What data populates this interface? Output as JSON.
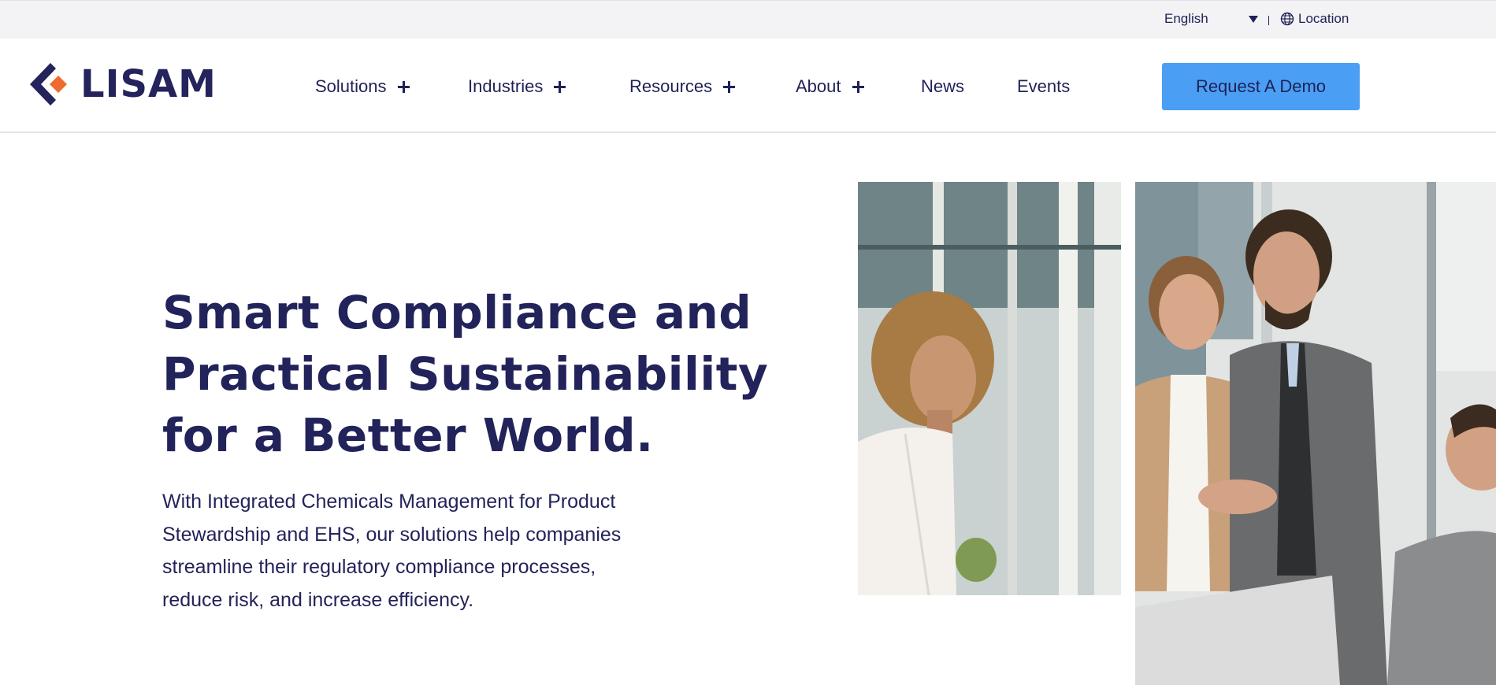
{
  "topbar": {
    "language": "English",
    "location": "Location",
    "icons": {
      "caret": "caret-down-icon",
      "globe": "globe-icon"
    }
  },
  "header": {
    "logo_text": "LISAM",
    "nav": [
      {
        "label": "Solutions",
        "expandable": true
      },
      {
        "label": "Industries",
        "expandable": true
      },
      {
        "label": "Resources",
        "expandable": true
      },
      {
        "label": "About",
        "expandable": true
      },
      {
        "label": "News",
        "expandable": false
      },
      {
        "label": "Events",
        "expandable": false
      }
    ],
    "cta": "Request A Demo"
  },
  "hero": {
    "title_lines": [
      "Smart Compliance and",
      "Practical Sustainability",
      "for a Better World."
    ],
    "description_lines": [
      "With Integrated Chemicals Management for Product",
      "Stewardship and EHS, our solutions help companies",
      "streamline their regulatory compliance processes,",
      "reduce risk, and increase efficiency."
    ]
  },
  "colors": {
    "navy": "#1f2156",
    "cta_blue": "#4a9ff5",
    "logo_orange": "#ef6a2c",
    "topbar_bg": "#f3f3f6"
  }
}
